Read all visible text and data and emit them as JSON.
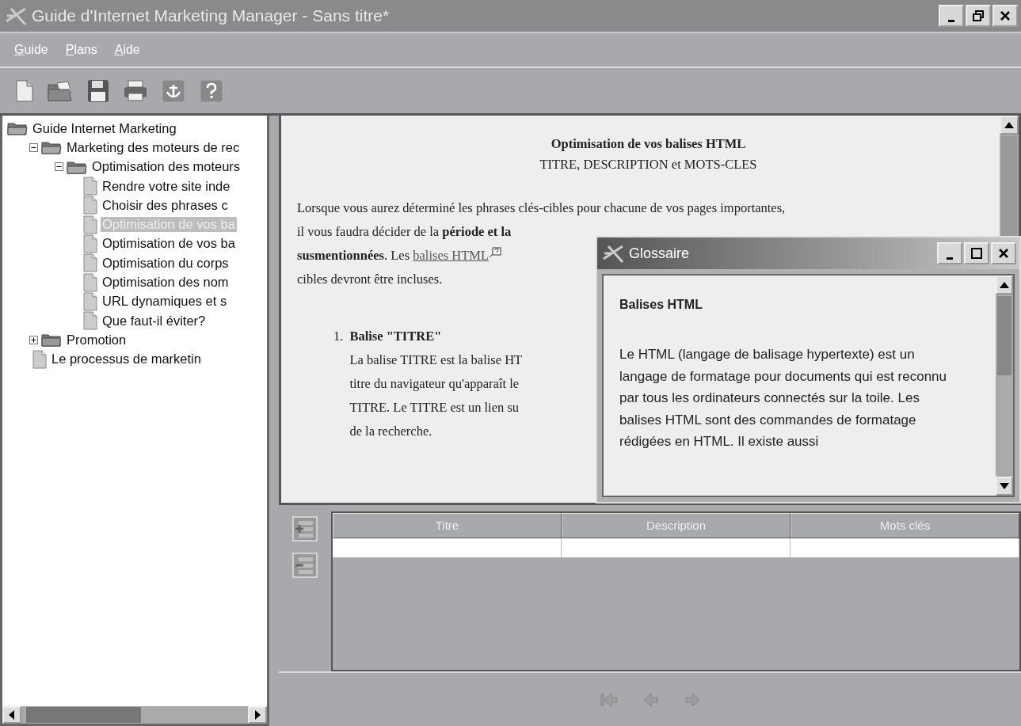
{
  "window": {
    "title": "Guide d'Internet Marketing Manager - Sans titre*"
  },
  "menu": [
    "Guide",
    "Plans",
    "Aide"
  ],
  "toolbar": [
    {
      "kind": "new"
    },
    {
      "kind": "open"
    },
    {
      "kind": "save"
    },
    {
      "kind": "print"
    },
    {
      "kind": "anchor"
    },
    {
      "kind": "help"
    }
  ],
  "tree": [
    {
      "label": "Guide Internet Marketing",
      "kind": "folder",
      "expanded": true,
      "selected": false,
      "children": [
        {
          "label": "Marketing des moteurs de rec",
          "kind": "folder",
          "expanded": true,
          "selected": false,
          "children": [
            {
              "label": "Optimisation des moteurs",
              "kind": "folder",
              "expanded": true,
              "selected": false,
              "children": [
                {
                  "label": "Rendre votre site inde",
                  "kind": "page",
                  "selected": false
                },
                {
                  "label": "Choisir des phrases c",
                  "kind": "page",
                  "selected": false
                },
                {
                  "label": "Optimisation de vos ba",
                  "kind": "page",
                  "selected": true
                },
                {
                  "label": "Optimisation de vos ba",
                  "kind": "page",
                  "selected": false
                },
                {
                  "label": "Optimisation du corps",
                  "kind": "page",
                  "selected": false
                },
                {
                  "label": "Optimisation des nom",
                  "kind": "page",
                  "selected": false
                },
                {
                  "label": "URL dynamiques et s",
                  "kind": "page",
                  "selected": false
                },
                {
                  "label": "Que faut-il éviter?",
                  "kind": "page",
                  "selected": false
                }
              ]
            }
          ]
        },
        {
          "label": "Promotion",
          "kind": "folder",
          "expanded": false,
          "selected": false
        },
        {
          "label": "Le processus de marketin",
          "kind": "page",
          "selected": false
        }
      ]
    }
  ],
  "article": {
    "title": "Optimisation de vos balises HTML",
    "subtitle": "TITRE, DESCRIPTION et MOTS-CLES",
    "lines": [
      {
        "text": "Lorsque vous aurez déterminé les phrases clés-cibles pour chacune de vos pages importantes,"
      },
      {
        "text": "il vous faudra décider de la **période et la**"
      },
      {
        "text": "**susmentionnées**. Les ",
        "link": "balises HTML",
        "help": true
      },
      {
        "text": "cibles devront être incluses."
      }
    ],
    "list": [
      {
        "number": "1.",
        "heading": "Balise \"TITRE\"",
        "lines": [
          "La balise TITRE est la balise HT",
          "titre du navigateur qu'apparaît le",
          "TITRE. Le TITRE est un lien su",
          "de la recherche."
        ]
      }
    ]
  },
  "glossary": {
    "title": "Glossaire",
    "term": "Balises HTML",
    "definition": "Le HTML (langage de balisage hypertexte) est un langage de formatage pour documents qui est reconnu par tous les ordinateurs connectés sur la toile. Les balises HTML sont des commandes de formatage rédigées en HTML. Il existe aussi"
  },
  "table": {
    "columns": [
      "Titre",
      "Description",
      "Mots clés"
    ]
  },
  "navigation": [
    {
      "kind": "first",
      "disabled": true
    },
    {
      "kind": "previous",
      "disabled": true
    },
    {
      "kind": "next",
      "disabled": true
    }
  ]
}
